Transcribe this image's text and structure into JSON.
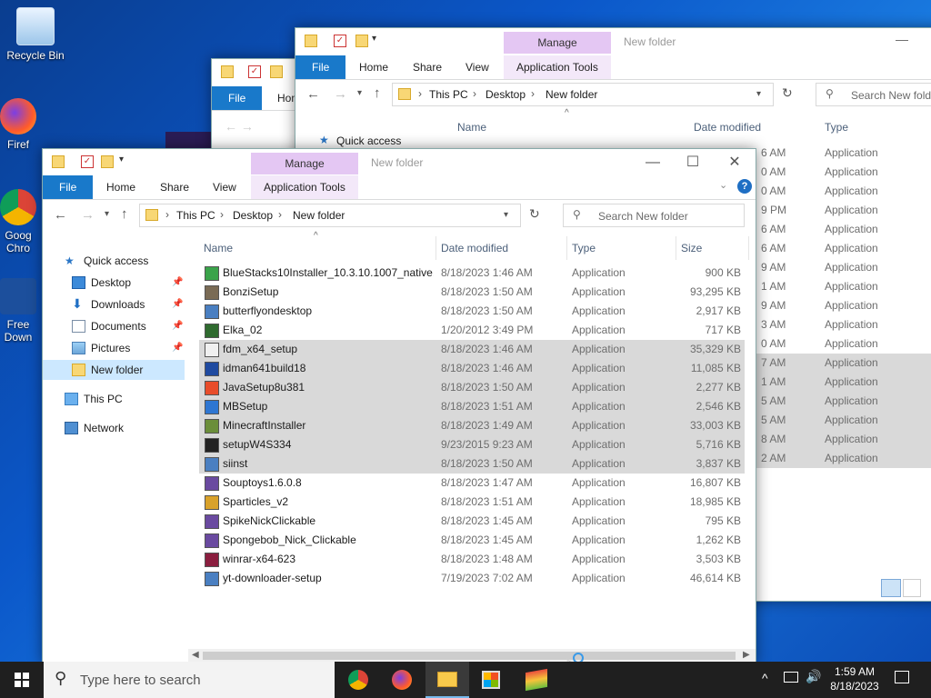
{
  "desktop": {
    "icons": [
      {
        "label": "Recycle Bin"
      },
      {
        "label": "Firef"
      },
      {
        "label": "Goog Chro"
      },
      {
        "label": "Free Down"
      }
    ]
  },
  "back_window": {
    "title": "New folder",
    "manage_label": "Manage",
    "tabs": [
      "File",
      "Home",
      "Share",
      "View",
      "Application Tools"
    ],
    "breadcrumb": [
      "This PC",
      "Desktop",
      "New folder"
    ],
    "search_placeholder": "Search New folder",
    "headers": {
      "name": "Name",
      "date": "Date modified",
      "type": "Type"
    },
    "quick_access": "Quick access",
    "visible_times": [
      "6 AM",
      "0 AM",
      "0 AM",
      "9 PM",
      "6 AM",
      "6 AM",
      "9 AM",
      "1 AM",
      "9 AM",
      "3 AM",
      "0 AM",
      "7 AM",
      "1 AM",
      "5 AM",
      "5 AM",
      "8 AM",
      "2 AM"
    ],
    "type_value": "Application"
  },
  "mid_window": {
    "tabs": [
      "File",
      "Hom"
    ]
  },
  "front_window": {
    "title": "New folder",
    "manage_label": "Manage",
    "tabs": [
      "File",
      "Home",
      "Share",
      "View",
      "Application Tools"
    ],
    "breadcrumb": [
      "This PC",
      "Desktop",
      "New folder"
    ],
    "search_placeholder": "Search New folder",
    "headers": {
      "name": "Name",
      "date": "Date modified",
      "type": "Type",
      "size": "Size"
    },
    "nav": {
      "quick_access": "Quick access",
      "items": [
        "Desktop",
        "Downloads",
        "Documents",
        "Pictures",
        "New folder"
      ],
      "this_pc": "This PC",
      "network": "Network"
    },
    "files": [
      {
        "name": "BlueStacks10Installer_10.3.10.1007_native...",
        "date": "8/18/2023 1:46 AM",
        "type": "Application",
        "size": "900 KB",
        "selected": false
      },
      {
        "name": "BonziSetup",
        "date": "8/18/2023 1:50 AM",
        "type": "Application",
        "size": "93,295 KB",
        "selected": false
      },
      {
        "name": "butterflyondesktop",
        "date": "8/18/2023 1:50 AM",
        "type": "Application",
        "size": "2,917 KB",
        "selected": false
      },
      {
        "name": "Elka_02",
        "date": "1/20/2012 3:49 PM",
        "type": "Application",
        "size": "717 KB",
        "selected": false
      },
      {
        "name": "fdm_x64_setup",
        "date": "8/18/2023 1:46 AM",
        "type": "Application",
        "size": "35,329 KB",
        "selected": true
      },
      {
        "name": "idman641build18",
        "date": "8/18/2023 1:46 AM",
        "type": "Application",
        "size": "11,085 KB",
        "selected": true
      },
      {
        "name": "JavaSetup8u381",
        "date": "8/18/2023 1:50 AM",
        "type": "Application",
        "size": "2,277 KB",
        "selected": true
      },
      {
        "name": "MBSetup",
        "date": "8/18/2023 1:51 AM",
        "type": "Application",
        "size": "2,546 KB",
        "selected": true
      },
      {
        "name": "MinecraftInstaller",
        "date": "8/18/2023 1:49 AM",
        "type": "Application",
        "size": "33,003 KB",
        "selected": true
      },
      {
        "name": "setupW4S334",
        "date": "9/23/2015 9:23 AM",
        "type": "Application",
        "size": "5,716 KB",
        "selected": true
      },
      {
        "name": "siinst",
        "date": "8/18/2023 1:50 AM",
        "type": "Application",
        "size": "3,837 KB",
        "selected": true
      },
      {
        "name": "Souptoys1.6.0.8",
        "date": "8/18/2023 1:47 AM",
        "type": "Application",
        "size": "16,807 KB",
        "selected": false
      },
      {
        "name": "Sparticles_v2",
        "date": "8/18/2023 1:51 AM",
        "type": "Application",
        "size": "18,985 KB",
        "selected": false
      },
      {
        "name": "SpikeNickClickable",
        "date": "8/18/2023 1:45 AM",
        "type": "Application",
        "size": "795 KB",
        "selected": false
      },
      {
        "name": "Spongebob_Nick_Clickable",
        "date": "8/18/2023 1:45 AM",
        "type": "Application",
        "size": "1,262 KB",
        "selected": false
      },
      {
        "name": "winrar-x64-623",
        "date": "8/18/2023 1:48 AM",
        "type": "Application",
        "size": "3,503 KB",
        "selected": false
      },
      {
        "name": "yt-downloader-setup",
        "date": "7/19/2023 7:02 AM",
        "type": "Application",
        "size": "46,614 KB",
        "selected": false
      }
    ],
    "icon_colors": [
      "#3aa34a",
      "#7a6b55",
      "#4a7fc1",
      "#2f6b2f",
      "#f0f0f0",
      "#1f4aa0",
      "#e84d2b",
      "#2e76d2",
      "#6b8e3a",
      "#222222",
      "#4a7fc1",
      "#6a4aa0",
      "#d9a22b",
      "#6a4aa0",
      "#6a4aa0",
      "#8b1e3f",
      "#4a7fc1"
    ]
  },
  "taskbar": {
    "search_placeholder": "Type here to search",
    "time": "1:59 AM",
    "date": "8/18/2023"
  }
}
